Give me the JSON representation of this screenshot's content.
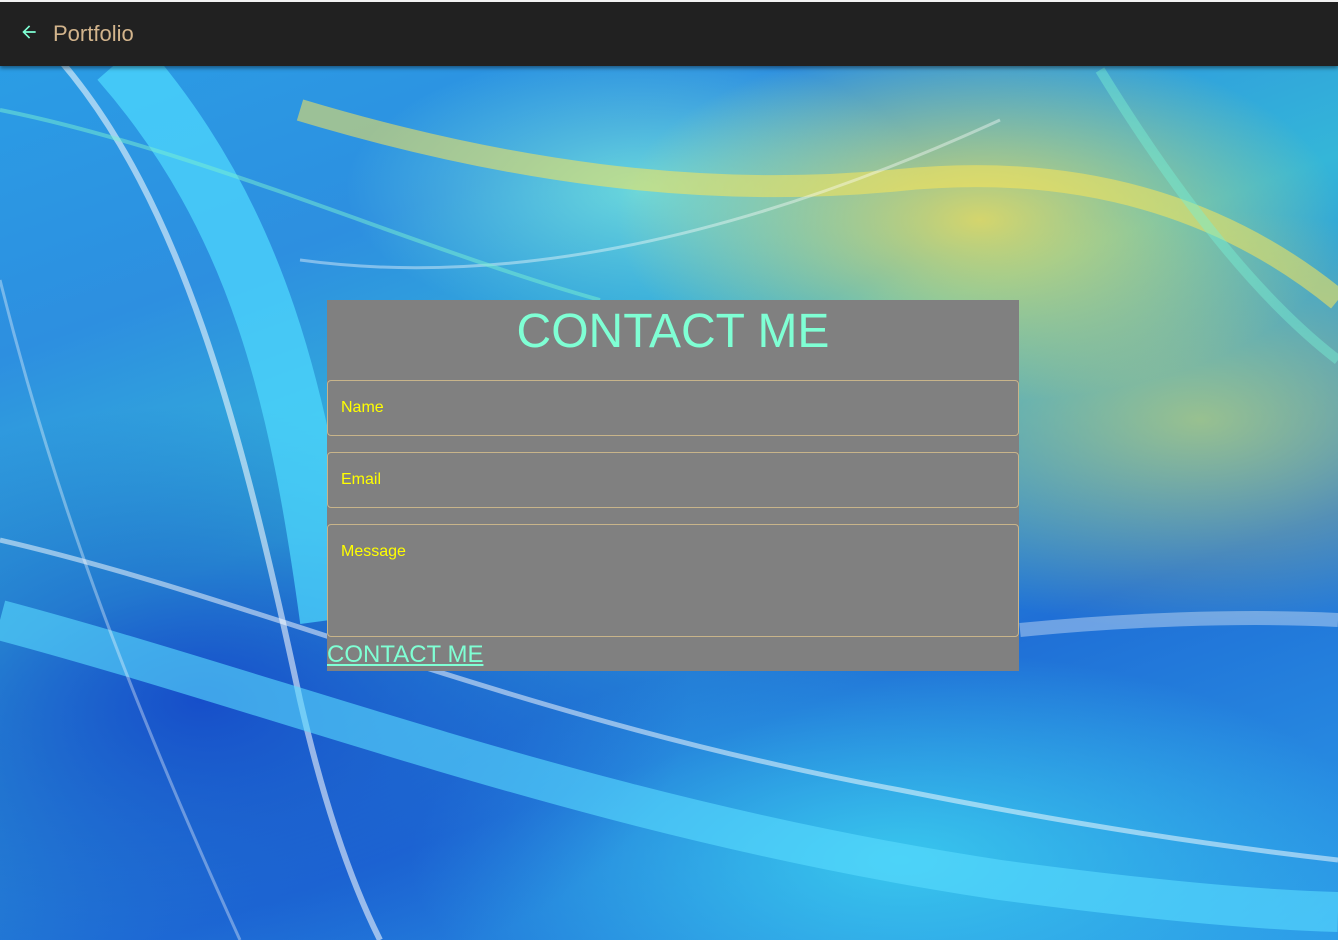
{
  "header": {
    "back_icon": "arrow-left-icon",
    "title": "Portfolio"
  },
  "contact": {
    "heading": "CONTACT ME",
    "name_placeholder": "Name",
    "email_placeholder": "Email",
    "message_placeholder": "Message",
    "submit_label": "CONTACT ME"
  },
  "colors": {
    "accent": "#7fffd4",
    "title_text": "#d2b48c",
    "field_text": "#ffff00",
    "card_bg": "#808080",
    "topbar_bg": "#212121"
  }
}
